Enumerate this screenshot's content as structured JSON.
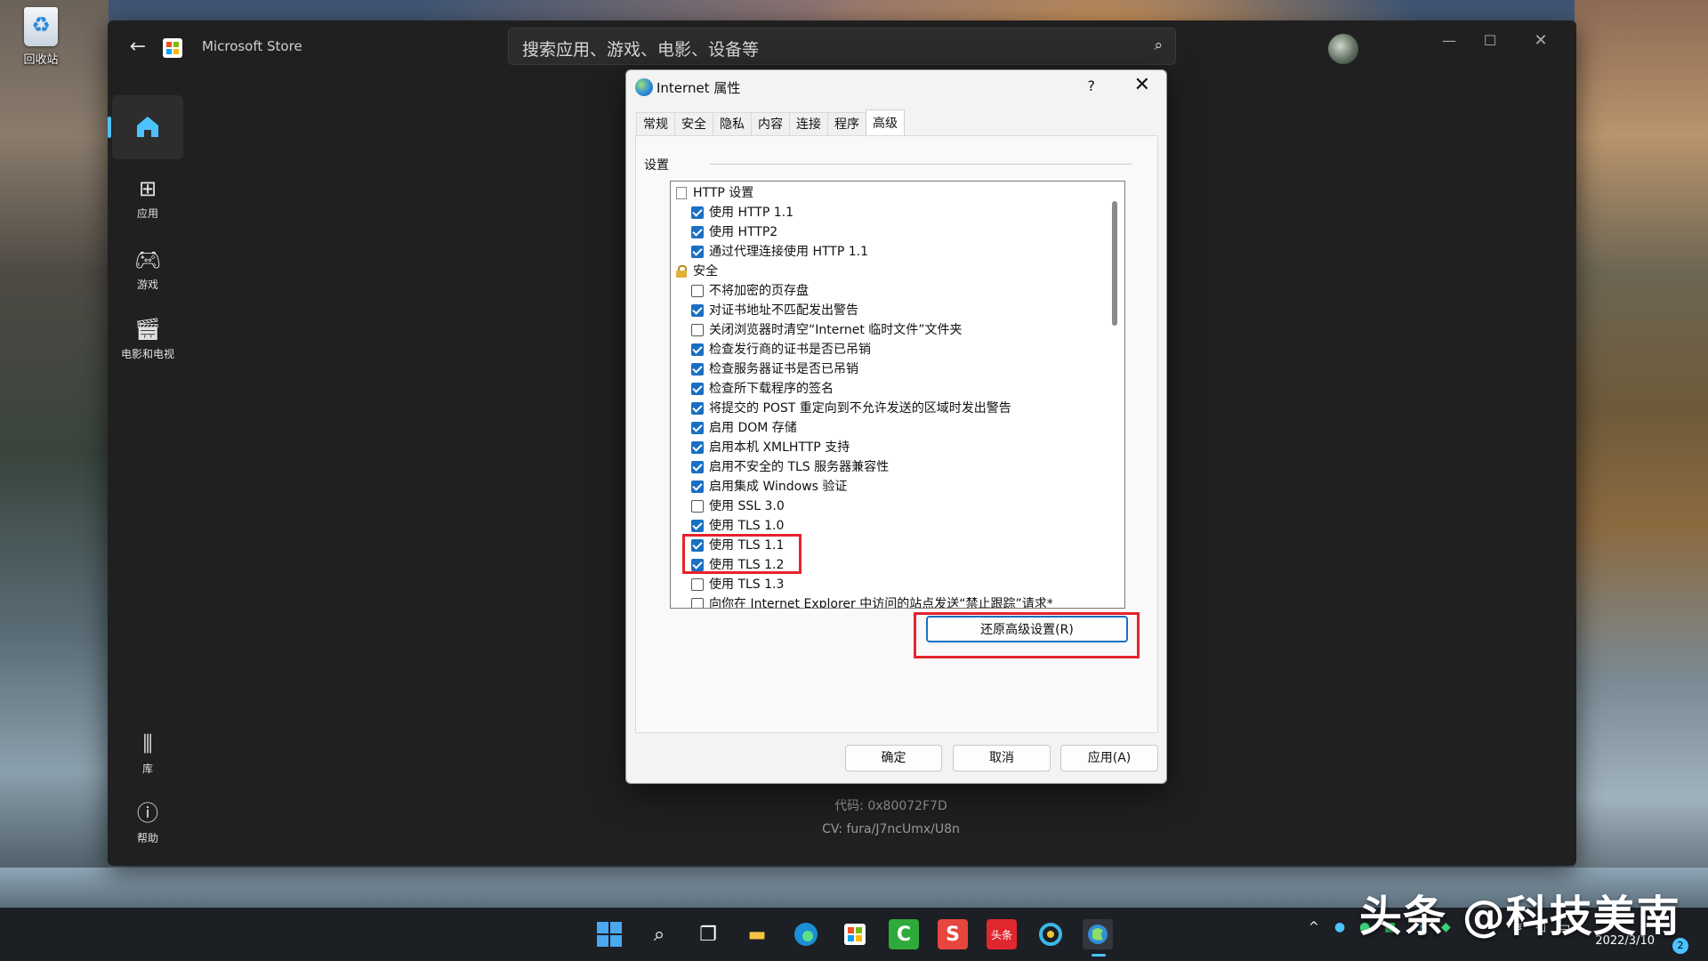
{
  "desktop": {
    "recycle_bin_label": "回收站",
    "watermark": "头条 @科技美南"
  },
  "store": {
    "title": "Microsoft Store",
    "search_placeholder": "搜索应用、游戏、电影、设备等",
    "nav": [
      {
        "label": "",
        "icon": "home-icon"
      },
      {
        "label": "应用",
        "icon": "apps-icon"
      },
      {
        "label": "游戏",
        "icon": "gamepad-icon"
      },
      {
        "label": "电影和电视",
        "icon": "movie-icon"
      },
      {
        "label": "库",
        "icon": "library-icon"
      },
      {
        "label": "帮助",
        "icon": "help-icon"
      }
    ],
    "error_code": "代码: 0x80072F7D",
    "cv": "CV: fura/J7ncUmx/U8n"
  },
  "dialog": {
    "title": "Internet 属性",
    "help": "?",
    "tabs": [
      "常规",
      "安全",
      "隐私",
      "内容",
      "连接",
      "程序",
      "高级"
    ],
    "active_tab": "高级",
    "group_label": "设置",
    "settings": [
      {
        "type": "category",
        "icon": "page-icon",
        "label": "HTTP 设置"
      },
      {
        "type": "check",
        "checked": true,
        "label": "使用 HTTP 1.1"
      },
      {
        "type": "check",
        "checked": true,
        "label": "使用 HTTP2"
      },
      {
        "type": "check",
        "checked": true,
        "label": "通过代理连接使用 HTTP 1.1"
      },
      {
        "type": "category",
        "icon": "lock-icon",
        "label": "安全"
      },
      {
        "type": "check",
        "checked": false,
        "label": "不将加密的页存盘"
      },
      {
        "type": "check",
        "checked": true,
        "label": "对证书地址不匹配发出警告"
      },
      {
        "type": "check",
        "checked": false,
        "label": "关闭浏览器时清空“Internet 临时文件”文件夹"
      },
      {
        "type": "check",
        "checked": true,
        "label": "检查发行商的证书是否已吊销"
      },
      {
        "type": "check",
        "checked": true,
        "label": "检查服务器证书是否已吊销"
      },
      {
        "type": "check",
        "checked": true,
        "label": "检查所下载程序的签名"
      },
      {
        "type": "check",
        "checked": true,
        "label": "将提交的 POST 重定向到不允许发送的区域时发出警告"
      },
      {
        "type": "check",
        "checked": true,
        "label": "启用 DOM 存储"
      },
      {
        "type": "check",
        "checked": true,
        "label": "启用本机 XMLHTTP 支持"
      },
      {
        "type": "check",
        "checked": true,
        "label": "启用不安全的 TLS 服务器兼容性"
      },
      {
        "type": "check",
        "checked": true,
        "label": "启用集成 Windows 验证"
      },
      {
        "type": "check",
        "checked": false,
        "label": "使用 SSL 3.0"
      },
      {
        "type": "check",
        "checked": true,
        "label": "使用 TLS 1.0"
      },
      {
        "type": "check",
        "checked": true,
        "label": "使用 TLS 1.1"
      },
      {
        "type": "check",
        "checked": true,
        "label": "使用 TLS 1.2"
      },
      {
        "type": "check",
        "checked": false,
        "label": "使用 TLS 1.3"
      },
      {
        "type": "check",
        "checked": false,
        "label": "向你在 Internet Explorer 中访问的站点发送“禁止跟踪”请求*"
      }
    ],
    "restore_button": "还原高级设置(R)",
    "ok_button": "确定",
    "cancel_button": "取消",
    "apply_button": "应用(A)"
  },
  "taskbar": {
    "apps": [
      "start-icon",
      "search-icon",
      "task-view-icon",
      "file-explorer-icon",
      "edge-icon",
      "store-icon",
      "camtasia-icon",
      "wps-icon",
      "toutiao-icon",
      "browser-icon",
      "internet-options-icon"
    ],
    "toutiao_label": "头条",
    "date": "2022/3/10",
    "notification_count": "2"
  },
  "colors": {
    "accent": "#4cc2ff",
    "highlight": "#e5232c",
    "checkbox": "#1a6fc2"
  }
}
